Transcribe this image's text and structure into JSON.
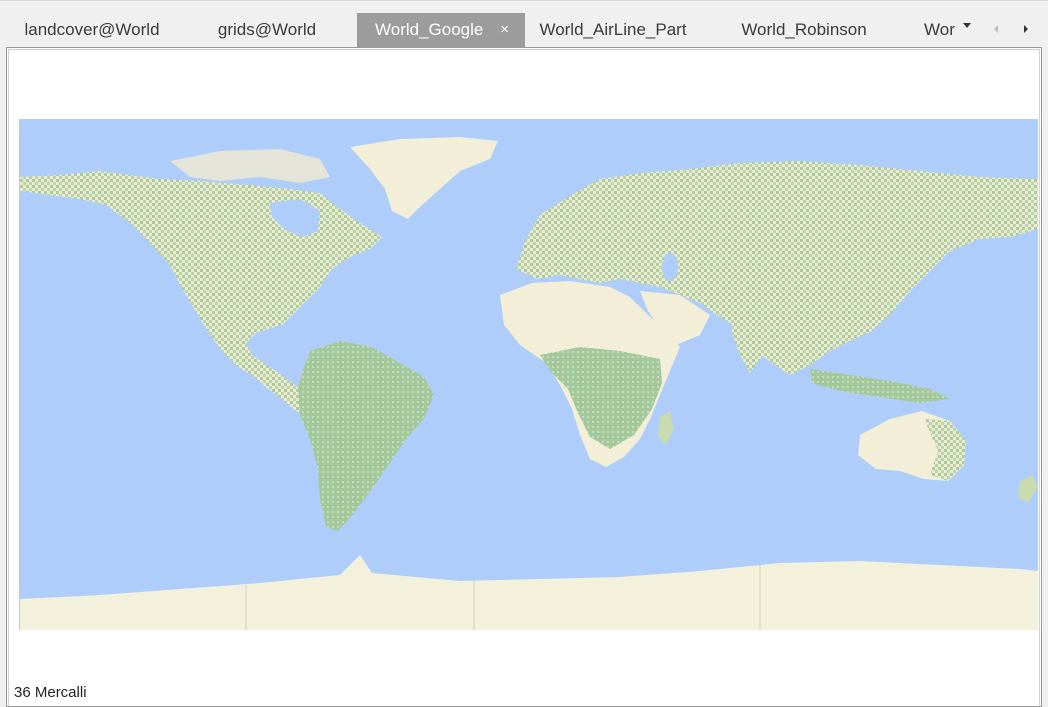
{
  "tabs": [
    {
      "label": "landcover@World",
      "active": false
    },
    {
      "label": "grids@World",
      "active": false
    },
    {
      "label": "World_Google",
      "active": true,
      "close_glyph": "×"
    },
    {
      "label": "World_AirLine_Part",
      "active": false
    },
    {
      "label": "World_Robinson",
      "active": false
    },
    {
      "label": "Wor",
      "active": false
    }
  ],
  "tab_controls": {
    "dropdown_icon": "chevron-down-icon",
    "scroll_left_icon": "caret-left-icon",
    "scroll_right_icon": "caret-right-icon"
  },
  "map": {
    "projection": "Mercator",
    "colors": {
      "ocean": "#aecdfa",
      "land_desert": "#f2eed8",
      "land_vegetation": "#a8cca0",
      "ice": "#f3f0dc",
      "active_tab": "#9c9c9c"
    }
  },
  "status": {
    "scale_text": "36 Mercalli"
  }
}
